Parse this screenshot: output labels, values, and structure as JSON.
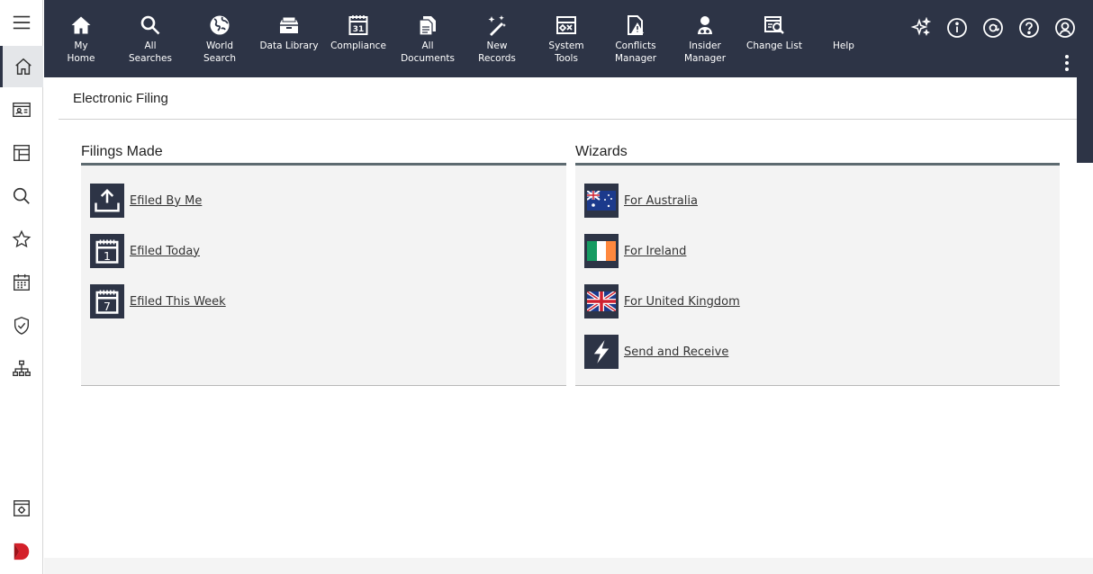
{
  "sidebar": {
    "items": [
      {
        "icon": "hamburger-menu-icon"
      },
      {
        "icon": "home-icon",
        "active": true
      },
      {
        "icon": "contact-card-icon"
      },
      {
        "icon": "layout-grid-icon"
      },
      {
        "icon": "search-icon"
      },
      {
        "icon": "star-icon"
      },
      {
        "icon": "calendar-icon"
      },
      {
        "icon": "shield-check-icon"
      },
      {
        "icon": "org-chart-icon"
      },
      {
        "icon": "settings-window-icon"
      },
      {
        "icon": "app-logo-icon"
      }
    ]
  },
  "topnav": {
    "items": [
      {
        "label": "My\nHome",
        "icon": "house-icon"
      },
      {
        "label": "All\nSearches",
        "icon": "magnifier-icon"
      },
      {
        "label": "World\nSearch",
        "icon": "globe-icon"
      },
      {
        "label": "Data Library",
        "icon": "file-drawer-icon"
      },
      {
        "label": "Compliance",
        "icon": "calendar-31-icon"
      },
      {
        "label": "All\nDocuments",
        "icon": "documents-icon"
      },
      {
        "label": "New\nRecords",
        "icon": "magic-wand-icon"
      },
      {
        "label": "System\nTools",
        "icon": "toolbox-icon"
      },
      {
        "label": "Conflicts\nManager",
        "icon": "document-warning-icon"
      },
      {
        "label": "Insider\nManager",
        "icon": "person-glasses-icon"
      },
      {
        "label": "Change List",
        "icon": "list-search-icon"
      },
      {
        "label": "Help",
        "icon": ""
      }
    ],
    "utility_icons": [
      "sparkle-icon",
      "info-icon",
      "at-sign-icon",
      "question-icon",
      "user-profile-icon"
    ],
    "more_icon": "kebab-menu-icon"
  },
  "page": {
    "title": "Electronic Filing"
  },
  "filings": {
    "title": "Filings Made",
    "links": [
      {
        "label": "Efiled By Me",
        "icon": "upload-tray-icon"
      },
      {
        "label": "Efiled Today",
        "icon": "calendar-1-icon"
      },
      {
        "label": "Efiled This Week",
        "icon": "calendar-7-icon"
      }
    ]
  },
  "wizards": {
    "title": "Wizards",
    "links": [
      {
        "label": "For Australia",
        "icon": "australia-flag-icon"
      },
      {
        "label": "For Ireland",
        "icon": "ireland-flag-icon"
      },
      {
        "label": "For United Kingdom",
        "icon": "uk-flag-icon"
      },
      {
        "label": "Send and Receive",
        "icon": "lightning-icon"
      }
    ]
  },
  "colors": {
    "nav_bg": "#2d3446",
    "panel_bg": "#f3f3f3",
    "panel_rule": "#5d6a70"
  }
}
